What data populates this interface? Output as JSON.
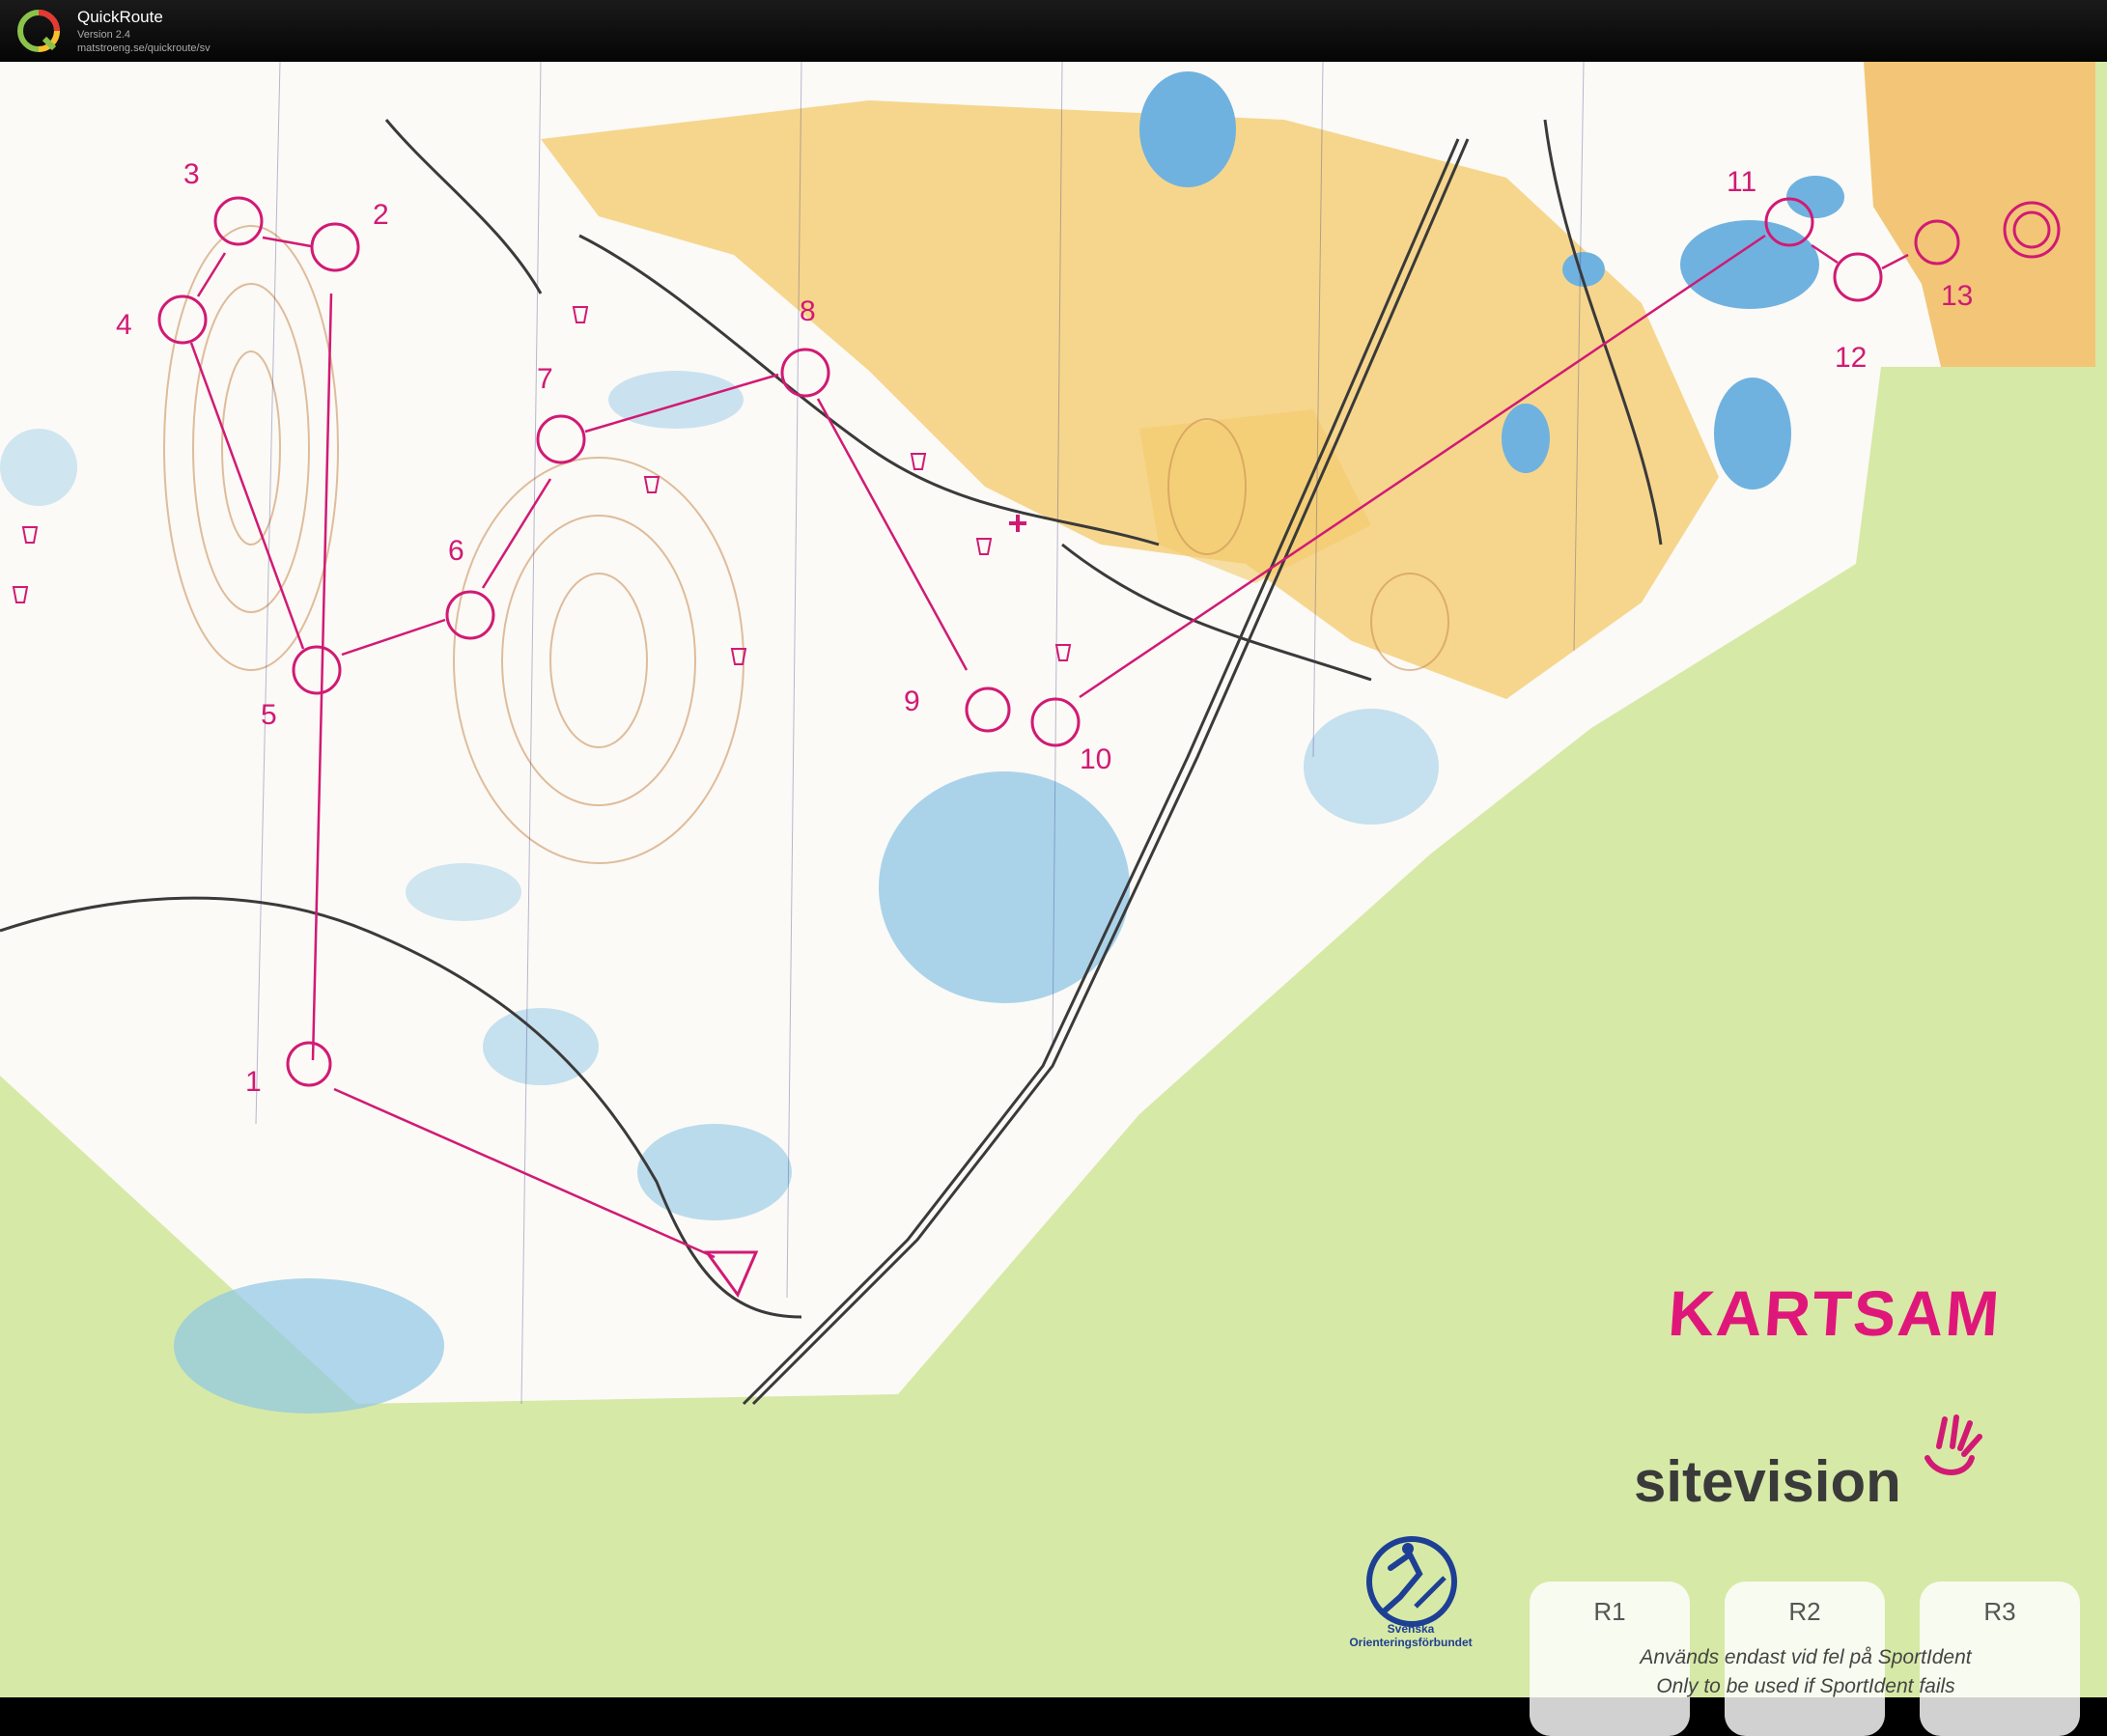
{
  "app": {
    "title": "QuickRoute",
    "version": "Version 2.4",
    "url": "matstroeng.se/quickroute/sv"
  },
  "course": {
    "color": "#d11a74",
    "controls": [
      "1",
      "2",
      "3",
      "4",
      "5",
      "6",
      "7",
      "8",
      "9",
      "10",
      "11",
      "12",
      "13"
    ]
  },
  "branding": {
    "kartsam": "KARTSAM",
    "sitevision": "sitevision",
    "federation_line1": "Svenska",
    "federation_line2": "Orienteringsförbundet"
  },
  "backup": {
    "boxes": [
      "R1",
      "R2",
      "R3"
    ],
    "note_sv": "Används endast vid fel på SportIdent",
    "note_en": "Only to be used if SportIdent fails"
  },
  "colors": {
    "open_land": "#f4c96a",
    "forest": "#fbfaf6",
    "water": "#8fc6e6",
    "margin_green": "#d7e9a6"
  }
}
